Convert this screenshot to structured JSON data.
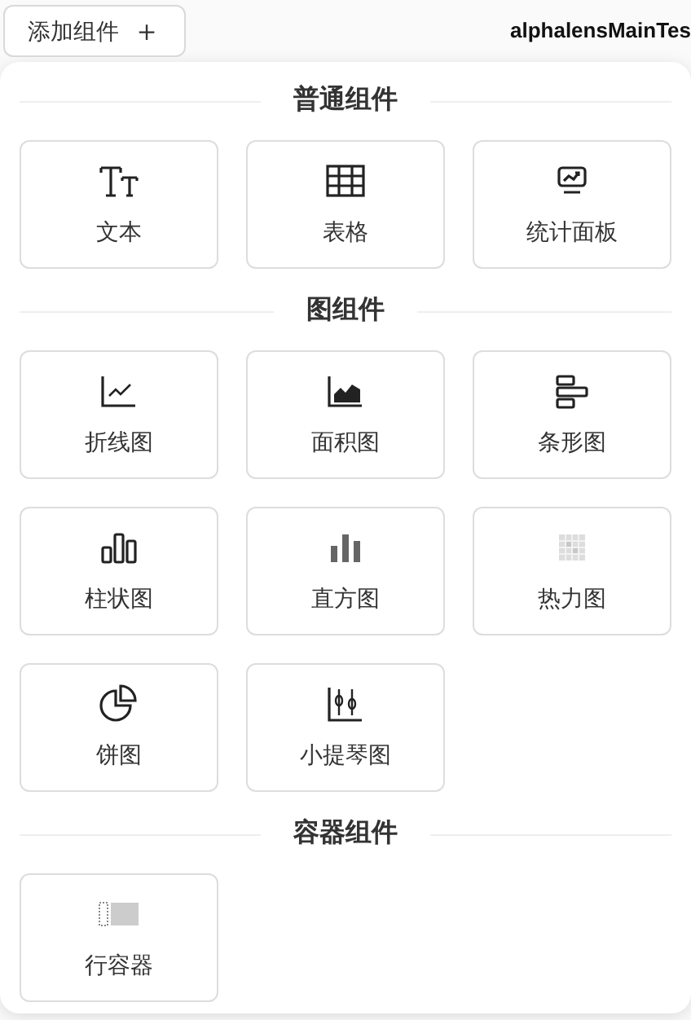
{
  "toolbar": {
    "add_button": {
      "label": "添加组件",
      "icon": "＋"
    },
    "title": "alphalensMainTes"
  },
  "sections": [
    {
      "title": "普通组件",
      "items": [
        {
          "label": "文本",
          "kind": "text"
        },
        {
          "label": "表格",
          "kind": "table"
        },
        {
          "label": "统计面板",
          "kind": "stat"
        }
      ]
    },
    {
      "title": "图组件",
      "items": [
        {
          "label": "折线图",
          "kind": "line"
        },
        {
          "label": "面积图",
          "kind": "area"
        },
        {
          "label": "条形图",
          "kind": "hbar"
        },
        {
          "label": "柱状图",
          "kind": "column"
        },
        {
          "label": "直方图",
          "kind": "histogram"
        },
        {
          "label": "热力图",
          "kind": "heatmap"
        },
        {
          "label": "饼图",
          "kind": "pie"
        },
        {
          "label": "小提琴图",
          "kind": "violin"
        }
      ]
    },
    {
      "title": "容器组件",
      "items": [
        {
          "label": "行容器",
          "kind": "row"
        }
      ]
    }
  ]
}
